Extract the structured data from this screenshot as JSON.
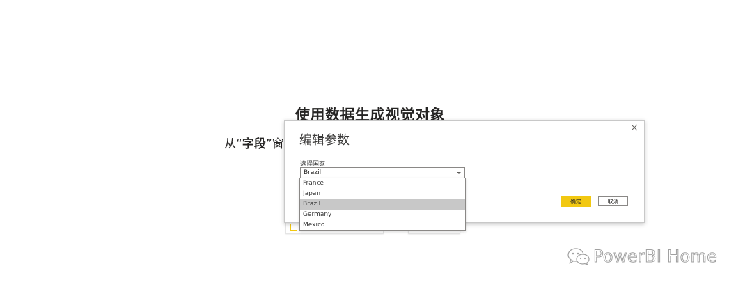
{
  "background": {
    "heading": "使用数据生成视觉对象",
    "text_prefix": "从“",
    "text_bold": "字段",
    "text_suffix": "”窗"
  },
  "dialog": {
    "title": "编辑参数",
    "field_label": "选择国家",
    "selected_value": "Brazil",
    "ok_label": "确定",
    "cancel_label": "取消"
  },
  "dropdown": {
    "options": [
      "France",
      "Japan",
      "Brazil",
      "Germany",
      "Mexico"
    ],
    "selected_index": 2
  },
  "watermark": {
    "text": "PowerBI Home"
  },
  "colors": {
    "accent": "#f2c811",
    "selected_option": "#c8c8c8",
    "border": "#8a8886"
  }
}
